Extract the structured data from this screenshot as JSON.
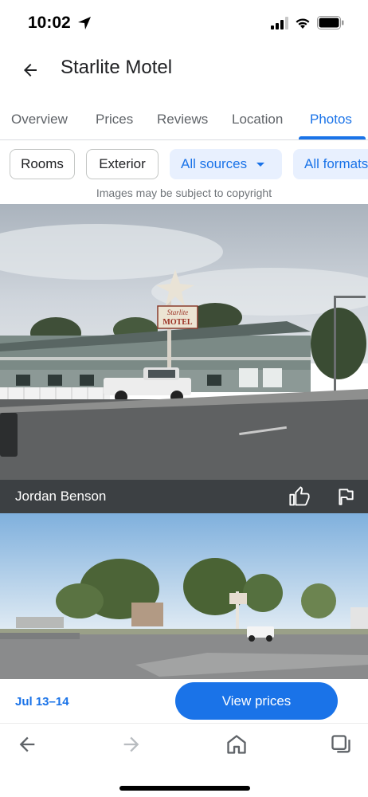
{
  "status": {
    "time": "10:02"
  },
  "header": {
    "title": "Starlite Motel"
  },
  "tabs": [
    {
      "label": "Overview"
    },
    {
      "label": "Prices"
    },
    {
      "label": "Reviews"
    },
    {
      "label": "Location"
    },
    {
      "label": "Photos",
      "active": true
    }
  ],
  "filters": {
    "rooms": "Rooms",
    "exterior": "Exterior",
    "sources": "All sources",
    "formats": "All formats"
  },
  "copyright_note": "Images may be subject to copyright",
  "photos": [
    {
      "author": "Jordan Benson",
      "sign_text_1": "Starlite",
      "sign_text_2": "MOTEL"
    },
    {}
  ],
  "booking": {
    "dates": "Jul 13–14",
    "cta": "View prices"
  },
  "colors": {
    "accent": "#1a73e8",
    "chip_fill": "#e8f0fe",
    "caption_bg": "#3c4043"
  },
  "browser_nav": {
    "icons": [
      "back-arrow-icon",
      "forward-arrow-icon",
      "home-icon",
      "tabs-icon"
    ]
  }
}
